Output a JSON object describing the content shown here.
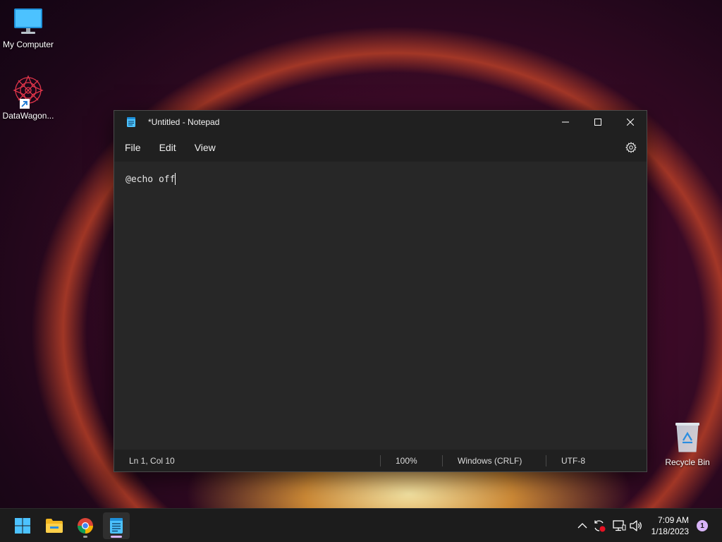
{
  "desktop": {
    "icons": [
      {
        "label": "My Computer",
        "icon": "monitor-icon"
      },
      {
        "label": "DataWagon...",
        "icon": "datawagon-icon"
      },
      {
        "label": "Recycle Bin",
        "icon": "recycle-bin-icon"
      }
    ]
  },
  "notepad": {
    "title": "*Untitled - Notepad",
    "menu": [
      "File",
      "Edit",
      "View"
    ],
    "content": "@echo off",
    "status": {
      "position": "Ln 1, Col 10",
      "zoom": "100%",
      "line_ending": "Windows (CRLF)",
      "encoding": "UTF-8"
    }
  },
  "taskbar": {
    "apps": [
      {
        "name": "Start",
        "icon": "windows-start-icon"
      },
      {
        "name": "File Explorer",
        "icon": "folder-icon"
      },
      {
        "name": "Google Chrome",
        "icon": "chrome-icon"
      },
      {
        "name": "Notepad",
        "icon": "notepad-icon",
        "active": true
      }
    ],
    "tray": {
      "time": "7:09 AM",
      "date": "1/18/2023",
      "notifications": "1"
    }
  },
  "colors": {
    "accent": "#4cc2ff",
    "window_bg": "#272727",
    "chrome_bg": "#202020",
    "taskbar_bg": "#1c1c1c",
    "badge": "#d8b4f8"
  }
}
